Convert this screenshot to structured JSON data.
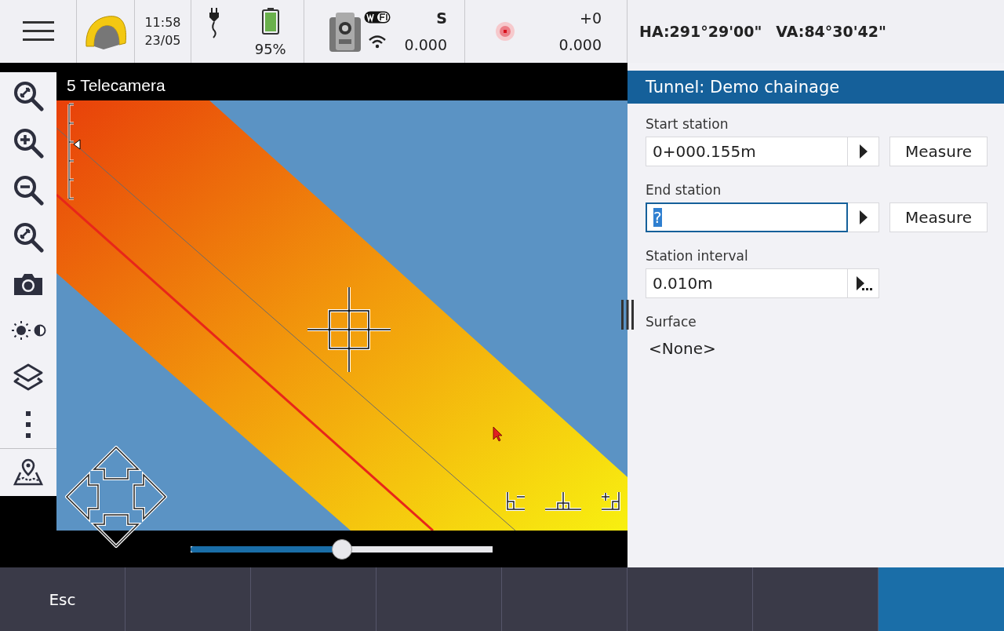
{
  "status_bar": {
    "time": "11:58",
    "date": "23/05",
    "battery": "95%",
    "instrument_label": "S",
    "instrument_value": "0.000",
    "target_label": "+0",
    "target_value": "0.000",
    "ha": "HA:291°29'00\"",
    "va": "VA:84°30'42\""
  },
  "video": {
    "title": "5 Telecamera",
    "zoom_slider": {
      "level": 0.5
    }
  },
  "panel": {
    "title": "Tunnel: Demo chainage",
    "fields": [
      {
        "kind": "measure",
        "label": "Start station",
        "value": "0+000.155m",
        "focused": false,
        "button": "Measure"
      },
      {
        "kind": "measure",
        "label": "End station",
        "value": "?",
        "focused": true,
        "button": "Measure"
      },
      {
        "kind": "list",
        "label": "Station interval",
        "value": "0.010m",
        "focused": false
      },
      {
        "kind": "text",
        "label": "Surface",
        "value": "<None>"
      }
    ]
  },
  "softkeys": [
    "Esc"
  ]
}
